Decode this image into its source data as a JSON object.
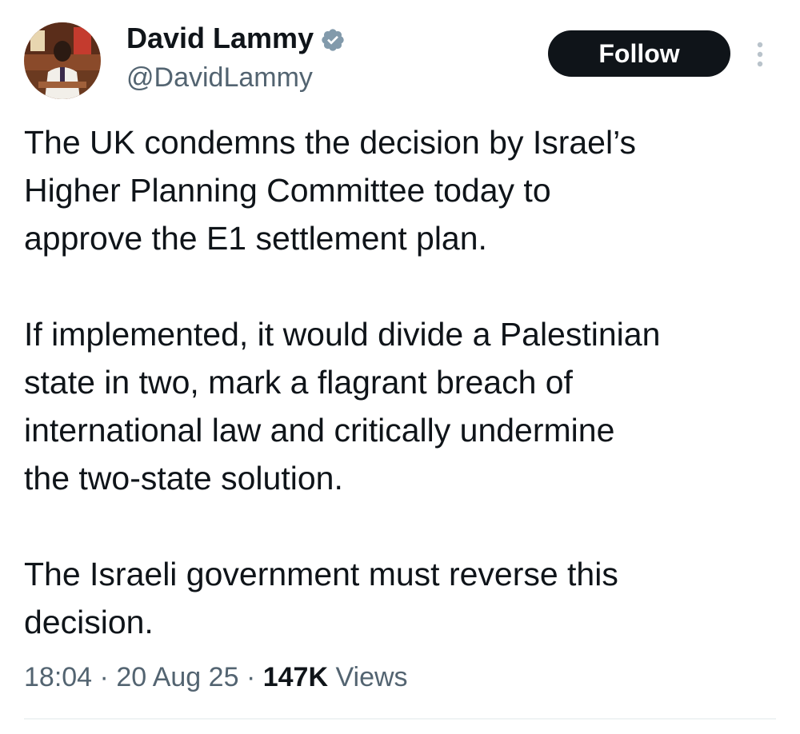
{
  "author": {
    "display_name": "David Lammy",
    "handle": "@DavidLammy",
    "verified": true,
    "verified_color": "#829aab"
  },
  "actions": {
    "follow_label": "Follow"
  },
  "tweet": {
    "paragraphs": [
      "The UK condemns the decision by Israel’s\nHigher Planning Committee today to\napprove the E1 settlement plan.",
      "If implemented, it would divide a Palestinian\nstate in two, mark a flagrant breach of\ninternational law and critically undermine\nthe two-state solution.",
      "The Israeli government must reverse this\ndecision."
    ]
  },
  "meta": {
    "time": "18:04",
    "separator": "·",
    "date": "20 Aug 25",
    "views_count": "147K",
    "views_label": "Views"
  },
  "icons": {
    "verified": "verified-badge-icon",
    "more": "more-vertical-icon"
  }
}
